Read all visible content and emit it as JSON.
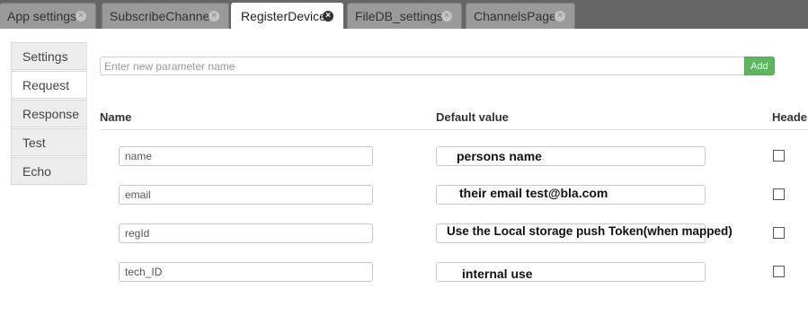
{
  "tabs": [
    {
      "label": "App settings",
      "active": false
    },
    {
      "label": "SubscribeChannel",
      "active": false
    },
    {
      "label": "RegisterDevice",
      "active": true
    },
    {
      "label": "FileDB_settings",
      "active": false
    },
    {
      "label": "ChannelsPage",
      "active": false
    }
  ],
  "side_tabs": [
    {
      "label": "Settings",
      "active": false
    },
    {
      "label": "Request",
      "active": true
    },
    {
      "label": "Response",
      "active": false
    },
    {
      "label": "Test",
      "active": false
    },
    {
      "label": "Echo",
      "active": false
    }
  ],
  "param_input": {
    "placeholder": "Enter new parameter name",
    "value": ""
  },
  "add_button": {
    "label": "Add"
  },
  "table": {
    "headers": {
      "name": "Name",
      "default": "Default value",
      "header": "Heade"
    },
    "rows": [
      {
        "name": "name",
        "default": "persons name",
        "header_checked": false
      },
      {
        "name": "email",
        "default": "their email test@bla.com",
        "header_checked": false
      },
      {
        "name": "regId",
        "default": "Use the Local storage push Token(when mapped)",
        "header_checked": false
      },
      {
        "name": "tech_ID",
        "default": "internal use",
        "header_checked": false
      }
    ]
  },
  "colors": {
    "tabbar_bg": "#666666",
    "tab_inactive": "#9a9a9a",
    "tab_active": "#ffffff",
    "add_button": "#5cb85c"
  },
  "icons": {
    "tab_close": "close-circle-icon"
  }
}
